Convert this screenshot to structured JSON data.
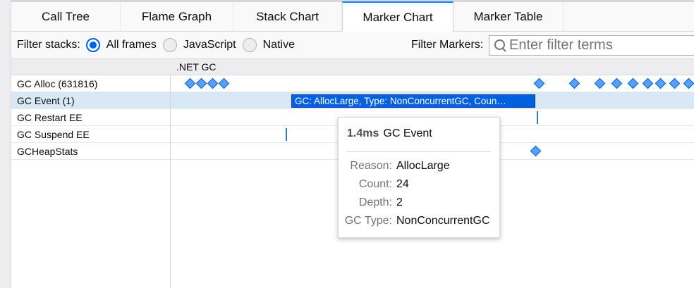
{
  "tabs": [
    "Call Tree",
    "Flame Graph",
    "Stack Chart",
    "Marker Chart",
    "Marker Table"
  ],
  "selected_tab": "Marker Chart",
  "filter": {
    "stacks_label": "Filter stacks:",
    "options": [
      "All frames",
      "JavaScript",
      "Native"
    ],
    "selected": "All frames",
    "markers_label": "Filter Markers:",
    "search_placeholder": "Enter filter terms"
  },
  "group_header": ".NET GC",
  "rows": [
    "GC Alloc (631816)",
    "GC Event (1)",
    "GC Restart EE",
    "GC Suspend EE",
    "GCHeapStats"
  ],
  "selected_row": "GC Event (1)",
  "gc_event_bar_label": "GC: AllocLarge, Type: NonConcurrentGC, Coun…",
  "tooltip": {
    "duration": "1.4ms",
    "title": "GC Event",
    "fields": [
      {
        "key": "Reason:",
        "value": "AllocLarge"
      },
      {
        "key": "Count:",
        "value": "24"
      },
      {
        "key": "Depth:",
        "value": "2"
      },
      {
        "key": "GC Type:",
        "value": "NonConcurrentGC"
      }
    ]
  },
  "colors": {
    "accent": "#0060df",
    "marker_fill": "#5aa0f0",
    "selected_row": "#d9e8f5"
  }
}
